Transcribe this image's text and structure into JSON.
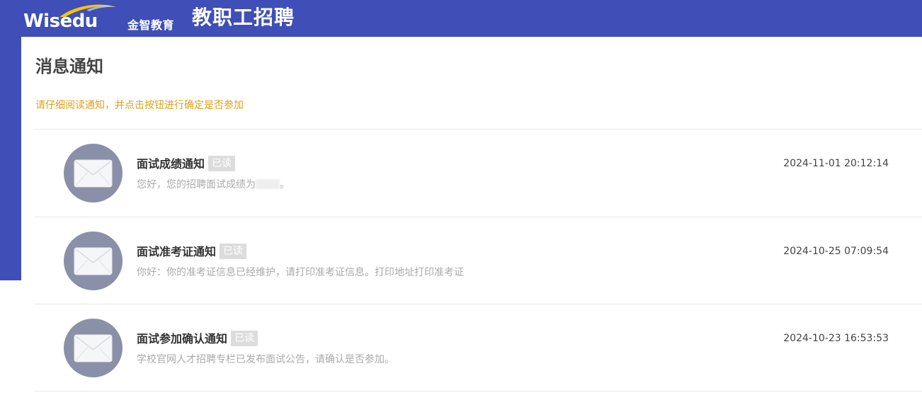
{
  "header": {
    "logo_word": "Wisedu",
    "logo_cn": "金智教育",
    "app_title": "教职工招聘"
  },
  "page": {
    "title": "消息通知",
    "hint": "请仔细阅读通知，并点击按钮进行确定是否参加"
  },
  "messages": [
    {
      "title": "面试成绩通知",
      "badge": "已读",
      "body_prefix": "您好，您的招聘面试成绩为",
      "body_suffix": "。",
      "time": "2024-11-01 20:12:14"
    },
    {
      "title": "面试准考证通知",
      "badge": "已读",
      "body": "你好：你的准考证信息已经维护，请打印准考证信息。打印地址打印准考证",
      "time": "2024-10-25 07:09:54"
    },
    {
      "title": "面试参加确认通知",
      "badge": "已读",
      "body": "学校官网人才招聘专栏已发布面试公告，请确认是否参加。",
      "time": "2024-10-23 16:53:53"
    }
  ],
  "colors": {
    "brand_blue": "#3f4fb7",
    "hint": "#d9a21b",
    "avatar": "#8990a8",
    "badge": "#dcdcdc",
    "logo_swoosh": "#f5c400"
  },
  "icons": {
    "logo_swoosh": "logo-swoosh",
    "message_avatar": "envelope-icon"
  }
}
